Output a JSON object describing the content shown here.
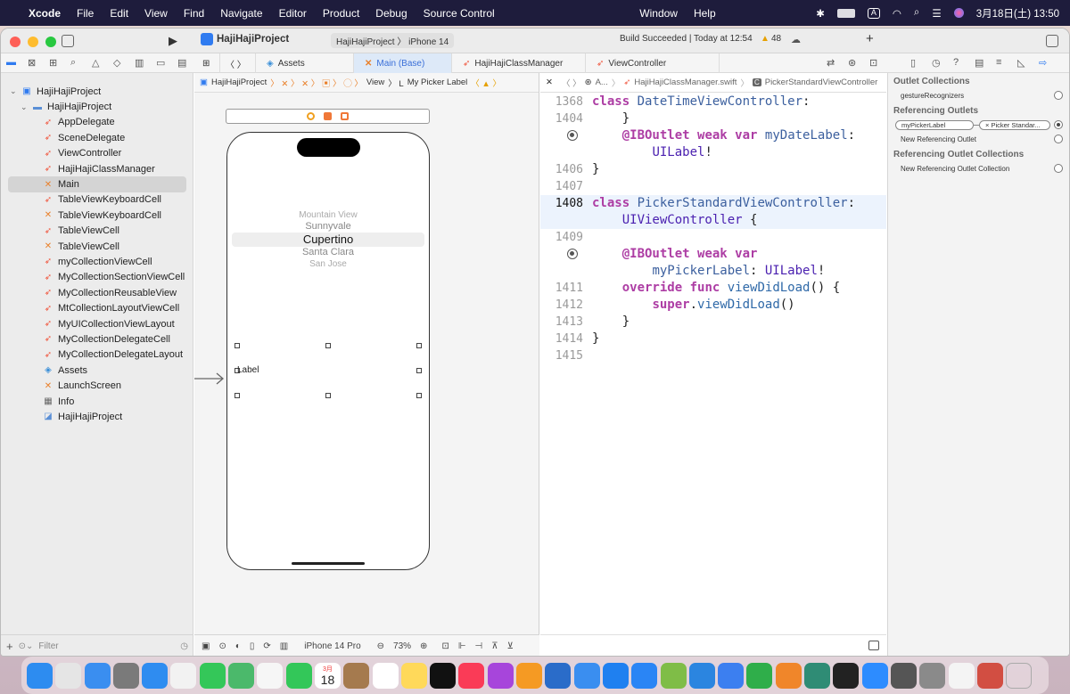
{
  "menubar": {
    "app": "Xcode",
    "items": [
      "File",
      "Edit",
      "View",
      "Find",
      "Navigate",
      "Editor",
      "Product",
      "Debug",
      "Source Control"
    ],
    "right_items": [
      "Window",
      "Help"
    ],
    "input_indicator": "A",
    "datetime": "3月18日(土) 13:50"
  },
  "titlebar": {
    "project": "HajiHajiProject",
    "scheme": "HajiHajiProject",
    "device": "iPhone 14",
    "build_status": "Build Succeeded | Today at 12:54",
    "warnings": "48"
  },
  "tabs": [
    {
      "label": "Assets",
      "icon": "asset-icon"
    },
    {
      "label": "Main (Base)",
      "icon": "xib-icon",
      "active": true
    },
    {
      "label": "HajiHajiClassManager",
      "icon": "swift-icon"
    },
    {
      "label": "ViewController",
      "icon": "swift-icon"
    }
  ],
  "navigator": {
    "items": [
      {
        "label": "HajiHajiProject",
        "indent": 0,
        "icon": "project-icon",
        "chev": "⌄"
      },
      {
        "label": "HajiHajiProject",
        "indent": 1,
        "icon": "folder-icon",
        "chev": "⌄"
      },
      {
        "label": "AppDelegate",
        "indent": 2,
        "icon": "swift-icon"
      },
      {
        "label": "SceneDelegate",
        "indent": 2,
        "icon": "swift-icon"
      },
      {
        "label": "ViewController",
        "indent": 2,
        "icon": "swift-icon"
      },
      {
        "label": "HajiHajiClassManager",
        "indent": 2,
        "icon": "swift-icon"
      },
      {
        "label": "Main",
        "indent": 2,
        "icon": "xib-icon",
        "selected": true
      },
      {
        "label": "TableViewKeyboardCell",
        "indent": 2,
        "icon": "swift-icon"
      },
      {
        "label": "TableViewKeyboardCell",
        "indent": 2,
        "icon": "xib-icon"
      },
      {
        "label": "TableViewCell",
        "indent": 2,
        "icon": "swift-icon"
      },
      {
        "label": "TableViewCell",
        "indent": 2,
        "icon": "xib-icon"
      },
      {
        "label": "myCollectionViewCell",
        "indent": 2,
        "icon": "swift-icon"
      },
      {
        "label": "MyCollectionSectionViewCell",
        "indent": 2,
        "icon": "swift-icon"
      },
      {
        "label": "MyCollectionReusableView",
        "indent": 2,
        "icon": "swift-icon"
      },
      {
        "label": "MtCollectionLayoutViewCell",
        "indent": 2,
        "icon": "swift-icon"
      },
      {
        "label": "MyUICollectionViewLayout",
        "indent": 2,
        "icon": "swift-icon"
      },
      {
        "label": "MyCollectionDelegateCell",
        "indent": 2,
        "icon": "swift-icon"
      },
      {
        "label": "MyCollectionDelegateLayout",
        "indent": 2,
        "icon": "swift-icon"
      },
      {
        "label": "Assets",
        "indent": 2,
        "icon": "asset-icon"
      },
      {
        "label": "LaunchScreen",
        "indent": 2,
        "icon": "xib-icon"
      },
      {
        "label": "Info",
        "indent": 2,
        "icon": "table-icon"
      },
      {
        "label": "HajiHajiProject",
        "indent": 2,
        "icon": "entitlement-icon"
      }
    ],
    "filter_placeholder": "Filter"
  },
  "canvas": {
    "jump": [
      "HajiHajiProject",
      "View",
      "My Picker Label"
    ],
    "picker_items": [
      "Mountain View",
      "Sunnyvale",
      "Cupertino",
      "Santa Clara",
      "San Jose"
    ],
    "selected_index": 2,
    "label_text": "Label",
    "device_label": "iPhone 14 Pro",
    "zoom": "73%"
  },
  "code": {
    "jump": [
      "A...",
      "HajiHajiClassManager.swift",
      "PickerStandardViewController"
    ],
    "lines": [
      {
        "n": "1368",
        "html": "<span class='kw'>class</span> <span class='tp'>DateTimeViewController</span>:"
      },
      {
        "n": "1404",
        "html": "    }"
      },
      {
        "n": "",
        "html": "    <span class='kw'>@IBOutlet</span> <span class='kw'>weak</span> <span class='kw'>var</span> <span class='tp'>myDateLabel</span>:",
        "dot": true
      },
      {
        "n": "",
        "html": "        <span class='ty'>UILabel</span>!"
      },
      {
        "n": "1406",
        "html": "}"
      },
      {
        "n": "1407",
        "html": ""
      },
      {
        "n": "1408",
        "html": "<span class='kw'>class</span> <span class='tp'>PickerStandardViewController</span>:",
        "cur": true
      },
      {
        "n": "",
        "html": "    <span class='ty'>UIViewController</span> {",
        "cur": true
      },
      {
        "n": "1409",
        "html": ""
      },
      {
        "n": "",
        "html": "    <span class='kw'>@IBOutlet</span> <span class='kw'>weak</span> <span class='kw'>var</span>",
        "dot": true
      },
      {
        "n": "",
        "html": "        <span class='tp'>myPickerLabel</span>: <span class='ty'>UILabel</span>!"
      },
      {
        "n": "1411",
        "html": "    <span class='kw'>override</span> <span class='kw'>func</span> <span class='fn'>viewDidLoad</span>() {"
      },
      {
        "n": "1412",
        "html": "        <span class='kw'>super</span>.<span class='fn'>viewDidLoad</span>()"
      },
      {
        "n": "1413",
        "html": "    }"
      },
      {
        "n": "1414",
        "html": "}"
      },
      {
        "n": "1415",
        "html": ""
      }
    ]
  },
  "inspector": {
    "outlet_collections": "Outlet Collections",
    "gesture": "gestureRecognizers",
    "referencing_outlets": "Referencing Outlets",
    "outlet_name": "myPickerLabel",
    "outlet_target": "Picker Standar...",
    "new_ref": "New Referencing Outlet",
    "ref_collections": "Referencing Outlet Collections",
    "new_ref_collection": "New Referencing Outlet Collection"
  },
  "dock": {
    "calendar_month": "3月",
    "calendar_day": "18",
    "apps": [
      "finder",
      "launchpad",
      "mail",
      "system-settings",
      "safari",
      "chrome",
      "messages",
      "maps",
      "photos",
      "facetime",
      "calendar",
      "notes-brown",
      "reminders",
      "notes",
      "tv",
      "music",
      "podcasts",
      "books",
      "xcode-instruments",
      "simulator",
      "xcode",
      "app-store",
      "numbers-check",
      "vscode",
      "keynote",
      "numbers",
      "pages",
      "chatgpt",
      "terminal",
      "zoom",
      "calculator",
      "preview",
      "textedit",
      "kotoeri",
      "trash"
    ],
    "colors": [
      "#2d8cf0",
      "#e5e5e5",
      "#3a8ef0",
      "#7a7a7a",
      "#2f8cf0",
      "#f2f2f2",
      "#34c759",
      "#4bb96b",
      "#f6f6f6",
      "#33c759",
      "#ffffff",
      "#a57a4e",
      "#ffffff",
      "#ffd95a",
      "#111111",
      "#fa3b57",
      "#a745db",
      "#f59a23",
      "#2a6cc9",
      "#3a8ef0",
      "#1f80f0",
      "#2a85f5",
      "#7fbd47",
      "#2b85e0",
      "#3c7ff0",
      "#2fae4a",
      "#f0862a",
      "#2f8c75",
      "#222222",
      "#2d8cff",
      "#555555",
      "#8a8a8a",
      "#f4f4f4",
      "#d24e42",
      "#c8c8c8"
    ]
  }
}
